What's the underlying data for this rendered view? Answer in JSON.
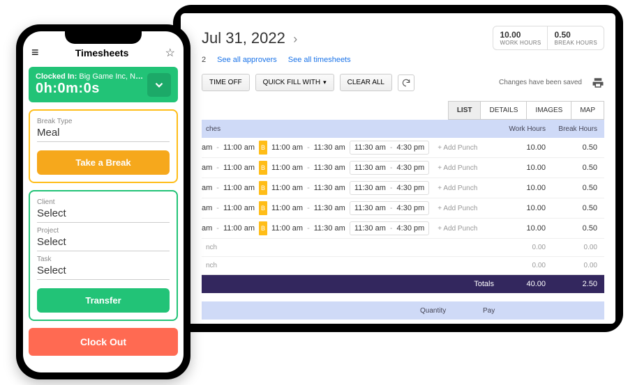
{
  "tablet": {
    "date_heading": "Jul 31, 2022",
    "stats": [
      {
        "value": "10.00",
        "label": "WORK HOURS"
      },
      {
        "value": "0.50",
        "label": "BREAK HOURS"
      }
    ],
    "links": {
      "num": "2",
      "approvers": "See all approvers",
      "timesheets": "See all timesheets"
    },
    "toolbar": {
      "time_off": "TIME OFF",
      "quick_fill": "QUICK FILL WITH",
      "clear_all": "CLEAR ALL",
      "saved_msg": "Changes have been saved"
    },
    "view_tabs": [
      "LIST",
      "DETAILS",
      "IMAGES",
      "MAP"
    ],
    "grid": {
      "col_punches": "ches",
      "col_wh": "Work Hours",
      "col_bh": "Break Hours",
      "rows": [
        {
          "t1a": "am",
          "t1b": "11:00 am",
          "b_t1": "11:00 am",
          "b_t2": "11:30 am",
          "box_t1": "11:30 am",
          "box_t2": "4:30 pm",
          "add": "+ Add Punch",
          "wh": "10.00",
          "bh": "0.50"
        },
        {
          "t1a": "am",
          "t1b": "11:00 am",
          "b_t1": "11:00 am",
          "b_t2": "11:30 am",
          "box_t1": "11:30 am",
          "box_t2": "4:30 pm",
          "add": "+ Add Punch",
          "wh": "10.00",
          "bh": "0.50"
        },
        {
          "t1a": "am",
          "t1b": "11:00 am",
          "b_t1": "11:00 am",
          "b_t2": "11:30 am",
          "box_t1": "11:30 am",
          "box_t2": "4:30 pm",
          "add": "+ Add Punch",
          "wh": "10.00",
          "bh": "0.50"
        },
        {
          "t1a": "am",
          "t1b": "11:00 am",
          "b_t1": "11:00 am",
          "b_t2": "11:30 am",
          "box_t1": "11:30 am",
          "box_t2": "4:30 pm",
          "add": "+ Add Punch",
          "wh": "10.00",
          "bh": "0.50"
        },
        {
          "t1a": "am",
          "t1b": "11:00 am",
          "b_t1": "11:00 am",
          "b_t2": "11:30 am",
          "box_t1": "11:30 am",
          "box_t2": "4:30 pm",
          "add": "+ Add Punch",
          "wh": "10.00",
          "bh": "0.50"
        }
      ],
      "mini_rows": [
        {
          "lbl": "nch",
          "wh": "0.00",
          "bh": "0.00"
        },
        {
          "lbl": "nch",
          "wh": "0.00",
          "bh": "0.00"
        }
      ],
      "totals": {
        "label": "Totals",
        "wh": "40.00",
        "bh": "2.50"
      },
      "section": {
        "qty": "Quantity",
        "pay": "Pay"
      }
    }
  },
  "phone": {
    "title": "Timesheets",
    "clock": {
      "line1_prefix": "Clocked In:",
      "line1_rest": "Big Game Inc, New …",
      "timer": "0h:0m:0s"
    },
    "break": {
      "type_label": "Break Type",
      "type_value": "Meal",
      "button": "Take a Break"
    },
    "transfer": {
      "client_label": "Client",
      "client_value": "Select",
      "project_label": "Project",
      "project_value": "Select",
      "task_label": "Task",
      "task_value": "Select",
      "button": "Transfer"
    },
    "clockout": "Clock Out"
  }
}
